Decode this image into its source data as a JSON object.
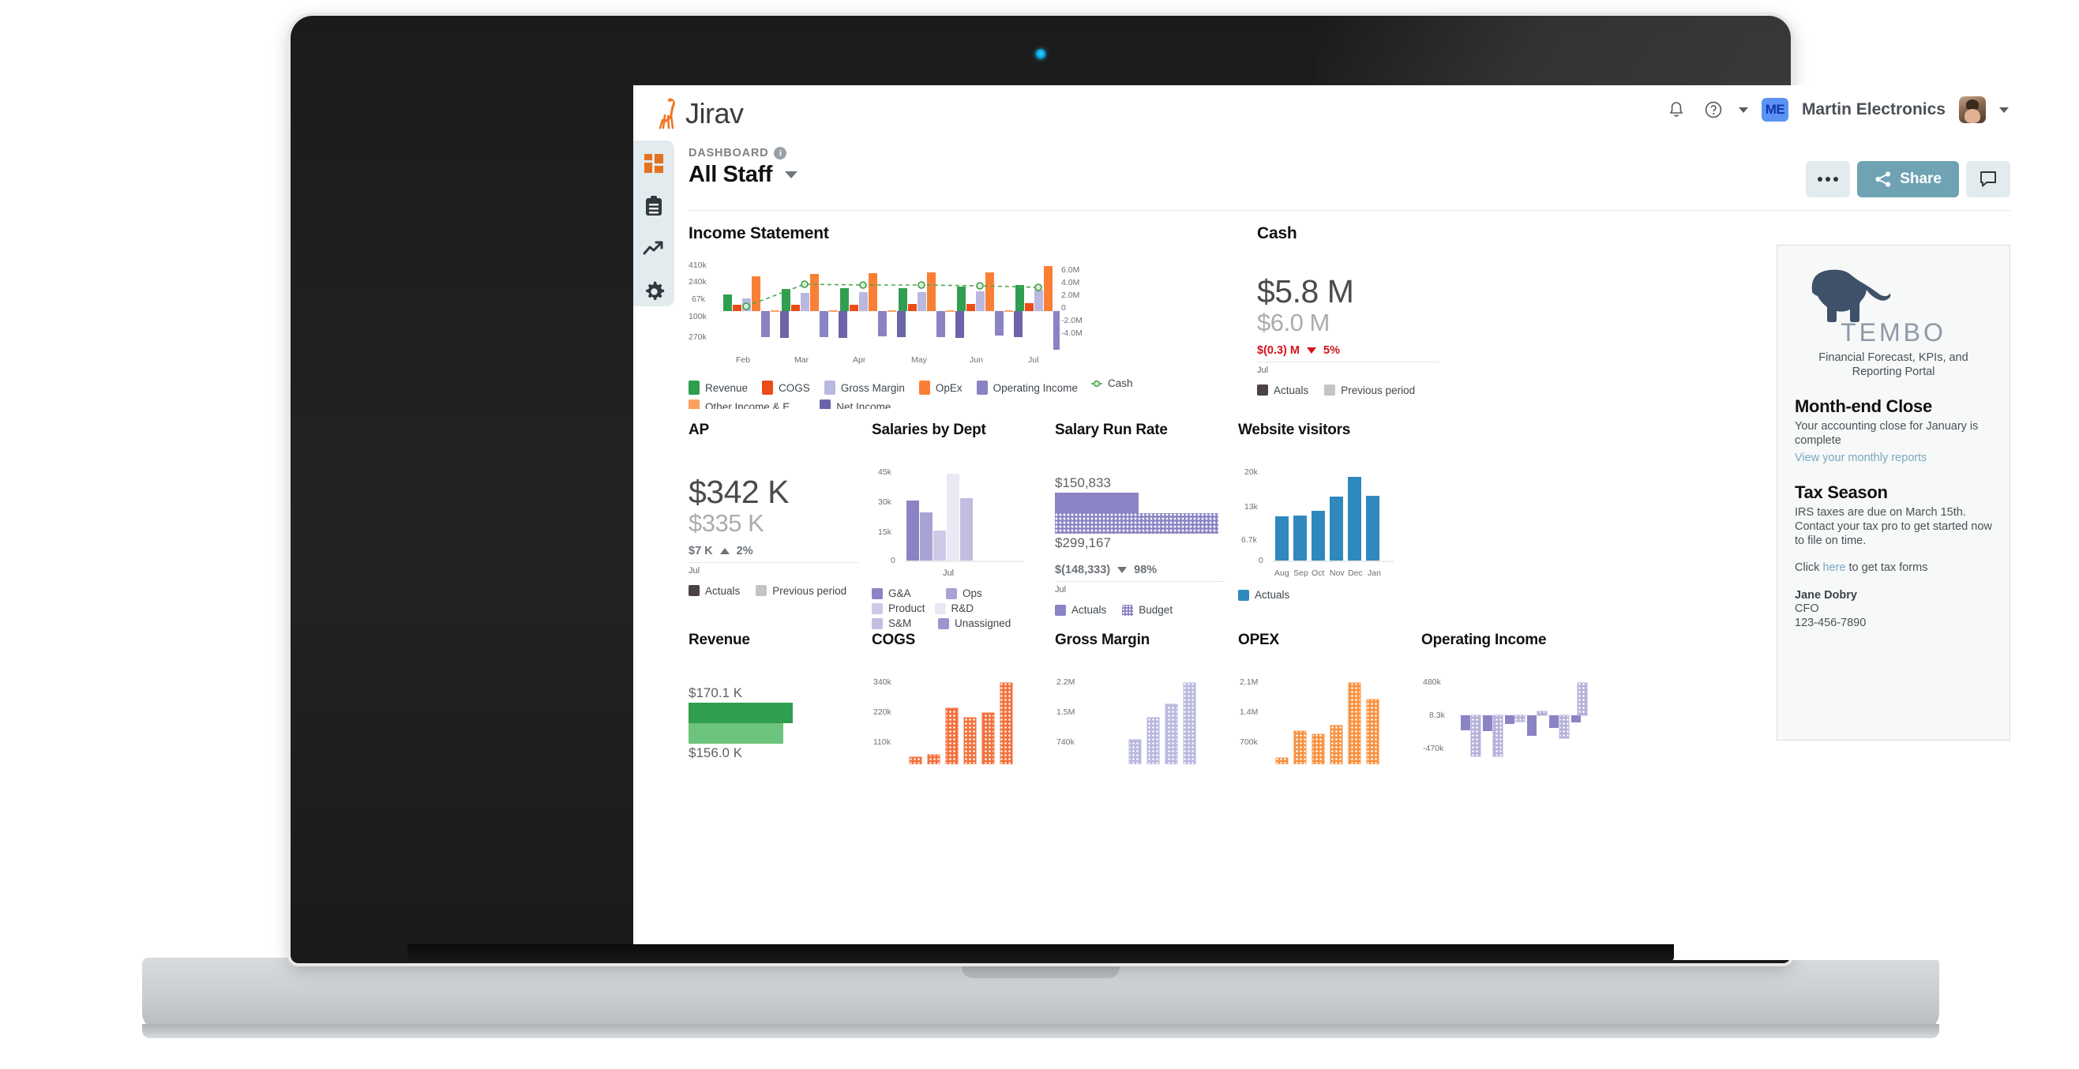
{
  "brand": {
    "name": "Jirav",
    "logo_icon": "giraffe-icon",
    "accent": "#ef7622"
  },
  "topbar": {
    "bell_icon": "bell-icon",
    "help_icon": "help-circle-icon",
    "help_caret_icon": "caret-down-icon",
    "org_initials": "ME",
    "org_name": "Martin Electronics",
    "avatar_icon": "user-avatar",
    "user_caret_icon": "caret-down-icon"
  },
  "rail": {
    "items": [
      {
        "name": "dashboard",
        "icon": "grid-squares-icon",
        "active": true
      },
      {
        "name": "reports",
        "icon": "clipboard-icon",
        "active": false
      },
      {
        "name": "trends",
        "icon": "trend-up-icon",
        "active": false
      },
      {
        "name": "settings",
        "icon": "gear-icon",
        "active": false
      }
    ]
  },
  "page": {
    "breadcrumb": "DASHBOARD",
    "info_icon": "info-icon",
    "title": "All Staff",
    "title_caret_icon": "chevron-down-icon",
    "more_label": "•••",
    "more_icon": "ellipsis-icon",
    "share_label": "Share",
    "share_icon": "share-nodes-icon",
    "comment_icon": "comment-icon"
  },
  "cards": {
    "income_statement": {
      "title": "Income Statement"
    },
    "cash": {
      "title": "Cash",
      "value": "$5.8 M",
      "previous": "$6.0 M",
      "delta": "$(0.3) M",
      "delta_pct": "5%",
      "delta_dir": "down",
      "delta_color": "#d4121b",
      "period": "Jul",
      "legend": [
        "Actuals",
        "Previous period"
      ]
    },
    "ap": {
      "title": "AP",
      "value": "$342 K",
      "previous": "$335 K",
      "delta": "$7 K",
      "delta_pct": "2%",
      "delta_dir": "up",
      "delta_color": "#6c7279",
      "period": "Jul",
      "legend": [
        "Actuals",
        "Previous period"
      ]
    },
    "salaries_by_dept": {
      "title": "Salaries by Dept"
    },
    "salary_run_rate": {
      "title": "Salary Run Rate",
      "actual_label": "$150,833",
      "budget_label": "$299,167",
      "delta": "$(148,333)",
      "delta_pct": "98%",
      "delta_dir": "down",
      "period": "Jul",
      "legend": [
        "Actuals",
        "Budget"
      ]
    },
    "website_visitors": {
      "title": "Website visitors",
      "legend": [
        "Actuals"
      ]
    },
    "revenue": {
      "title": "Revenue",
      "actual_label": "$170.1 K",
      "previous_label": "$156.0 K"
    },
    "cogs": {
      "title": "COGS"
    },
    "gross_margin": {
      "title": "Gross Margin"
    },
    "opex": {
      "title": "OPEX"
    },
    "operating_income": {
      "title": "Operating Income"
    }
  },
  "tembo": {
    "logo_icon": "elephant-icon",
    "wordmark": "TEMBO",
    "tagline": "Financial Forecast, KPIs, and Reporting Portal",
    "sections": [
      {
        "heading": "Month-end Close",
        "body": "Your accounting close for January is complete",
        "link": "View your monthly reports"
      },
      {
        "heading": "Tax Season",
        "body": "IRS taxes are due on March 15th. Contact your tax pro to get started now to file on time.",
        "click_prefix": "Click ",
        "click_link": "here",
        "click_suffix": " to get tax forms"
      }
    ],
    "signature": {
      "name": "Jane Dobry",
      "role": "CFO",
      "phone": "123-456-7890"
    }
  },
  "colors": {
    "revenue": "#2f9e4f",
    "cogs": "#ec4c18",
    "gross_margin": "#b9b8e0",
    "opex": "#f97f35",
    "operating_income": "#8983c4",
    "other_income": "#fba05f",
    "net_income": "#6b64a8",
    "cash_line": "#4aa84f",
    "visitors": "#3089bd",
    "actuals_dark": "#4a4246",
    "previous_grey": "#c4c4c4",
    "share_btn": "#6fa3b4",
    "rail_bg": "#e2ebee"
  },
  "chart_data": [
    {
      "type": "bar",
      "name": "income-statement",
      "title": "Income Statement",
      "categories": [
        "Feb",
        "Mar",
        "Apr",
        "May",
        "Jun",
        "Jul"
      ],
      "ylabel": "",
      "xlabel": "",
      "ytick_labels": [
        "410k",
        "240k",
        "67k",
        "100k",
        "270k"
      ],
      "ytick_values": [
        410000,
        240000,
        67000,
        -100000,
        -270000
      ],
      "y2tick_labels": [
        "6.0M",
        "4.0M",
        "2.0M",
        "0",
        "-2.0M",
        "-4.0M"
      ],
      "y2tick_values": [
        6000000,
        4000000,
        2000000,
        0,
        -2000000,
        -4000000
      ],
      "ylim": [
        -330000,
        460000
      ],
      "grid": false,
      "legend_position": "bottom",
      "series": [
        {
          "name": "Revenue",
          "color": "#2f9e4f",
          "values": [
            90000,
            125000,
            130000,
            133000,
            140000,
            152000
          ]
        },
        {
          "name": "COGS",
          "color": "#ec4c18",
          "values": [
            35000,
            35000,
            33000,
            38000,
            36000,
            40000
          ]
        },
        {
          "name": "Gross Margin",
          "color": "#b9b8e0",
          "values": [
            66000,
            102000,
            108000,
            110000,
            112000,
            125000
          ]
        },
        {
          "name": "OpEx",
          "color": "#f97f35",
          "values": [
            252000,
            272000,
            285000,
            283000,
            288000,
            410000
          ]
        },
        {
          "name": "Operating Income",
          "color": "#8983c4",
          "values": [
            -182000,
            -180000,
            -176000,
            -178000,
            -172000,
            -285000
          ]
        },
        {
          "name": "Other Income & E",
          "color": "#fba05f",
          "values": [
            1000,
            1000,
            1000,
            1000,
            1000,
            1000
          ]
        },
        {
          "name": "Net Income",
          "color": "#6b64a8",
          "values": [
            -186000,
            -184000,
            -180000,
            -182000,
            -176000,
            -300000
          ]
        }
      ],
      "line_series": {
        "name": "Cash",
        "color": "#4aa84f",
        "style": "dashed",
        "axis": "right",
        "values": [
          450000,
          5600000,
          5550000,
          5500000,
          5480000,
          5400000
        ]
      }
    },
    {
      "type": "bar",
      "name": "salaries-by-dept",
      "title": "Salaries by Dept",
      "categories": [
        "Jul"
      ],
      "ytick_labels": [
        "45k",
        "30k",
        "15k",
        "0"
      ],
      "ylim": [
        0,
        48000
      ],
      "legend_position": "bottom",
      "series": [
        {
          "name": "G&A",
          "color": "#8b84c4",
          "values": [
            30500
          ]
        },
        {
          "name": "Ops",
          "color": "#a9a3d4",
          "values": [
            24500
          ]
        },
        {
          "name": "Product",
          "color": "#cdcae7",
          "values": [
            15500
          ]
        },
        {
          "name": "R&D",
          "color": "#e9e8f5",
          "values": [
            45000
          ]
        },
        {
          "name": "S&M",
          "color": "#c2bee2",
          "values": [
            31500
          ]
        },
        {
          "name": "Unassigned",
          "color": "#9b95cd",
          "values": [
            0
          ]
        }
      ]
    },
    {
      "type": "bar",
      "name": "salary-run-rate",
      "title": "Salary Run Rate",
      "orientation": "horizontal",
      "categories": [
        "Actuals",
        "Budget"
      ],
      "values": [
        150833,
        299167
      ],
      "value_labels": [
        "$150,833",
        "$299,167"
      ],
      "colors": [
        "#8b84c4",
        "#8b84c4"
      ],
      "budget_pattern": "dotted"
    },
    {
      "type": "bar",
      "name": "website-visitors",
      "title": "Website visitors",
      "categories": [
        "Aug",
        "Sep",
        "Oct",
        "Nov",
        "Dec",
        "Jan"
      ],
      "values": [
        10500,
        10700,
        11800,
        15200,
        19800,
        15400
      ],
      "ytick_labels": [
        "20k",
        "13k",
        "6.7k",
        "0"
      ],
      "ylim": [
        0,
        21000
      ],
      "color": "#3089bd",
      "legend_position": "bottom",
      "legend": [
        "Actuals"
      ]
    },
    {
      "type": "bar",
      "name": "revenue",
      "title": "Revenue",
      "orientation": "horizontal",
      "categories": [
        "Actuals",
        "Previous"
      ],
      "values": [
        170100,
        156000
      ],
      "value_labels": [
        "$170.1 K",
        "$156.0 K"
      ],
      "colors": [
        "#2f9e4f",
        "#6cc37c"
      ]
    },
    {
      "type": "bar",
      "name": "cogs",
      "title": "COGS",
      "categories": [
        "",
        "",
        "",
        "",
        "",
        ""
      ],
      "values": [
        28000,
        38000,
        230000,
        196000,
        215000,
        338000
      ],
      "ytick_labels": [
        "340k",
        "220k",
        "110k"
      ],
      "ylim": [
        0,
        360000
      ],
      "color": "#f4703c",
      "pattern": "dotted"
    },
    {
      "type": "bar",
      "name": "gross-margin",
      "title": "Gross Margin",
      "categories": [
        "",
        "",
        "",
        "",
        "",
        ""
      ],
      "values": [
        0,
        0,
        790000,
        1380000,
        1750000,
        2170000
      ],
      "ytick_labels": [
        "2.2M",
        "1.5M",
        "740k"
      ],
      "ylim": [
        0,
        2300000
      ],
      "color": "#b9b8e0",
      "pattern": "dotted"
    },
    {
      "type": "bar",
      "name": "opex",
      "title": "OPEX",
      "categories": [
        "",
        "",
        "",
        "",
        "",
        ""
      ],
      "values": [
        712000,
        1180000,
        1110000,
        1330000,
        2080000,
        1830000
      ],
      "ytick_labels": [
        "2.1M",
        "1.4M",
        "700k"
      ],
      "ylim": [
        0,
        2200000
      ],
      "color": "#f97f35",
      "pattern": "dotted"
    },
    {
      "type": "bar",
      "name": "operating-income",
      "title": "Operating Income",
      "categories": [
        "",
        "",
        "",
        "",
        "",
        ""
      ],
      "series": [
        {
          "name": "Actuals",
          "color": "#8b84c4",
          "values": [
            -170000,
            -180000,
            -90000,
            -230000,
            -140000,
            -80000
          ]
        },
        {
          "name": "Budget",
          "color": "#b6b1da",
          "values": [
            -470000,
            -470000,
            -70000,
            40000,
            -260000,
            460000
          ]
        }
      ],
      "ytick_labels": [
        "480k",
        "8.3k",
        "-470k"
      ],
      "ylim": [
        -520000,
        520000
      ],
      "pattern": "dotted"
    }
  ]
}
